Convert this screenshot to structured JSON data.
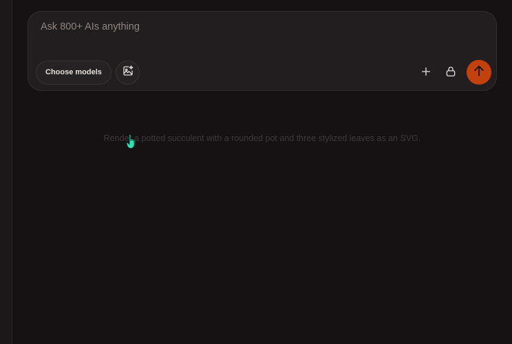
{
  "composer": {
    "placeholder": "Ask 800+ AIs anything",
    "choose_models_label": "Choose models",
    "image_gen_icon": "image-sparkle-icon",
    "plus_icon": "plus-icon",
    "lock_icon": "lock-icon",
    "send_icon": "arrow-up-icon",
    "send_color": "#c2410c"
  },
  "suggestion": {
    "text": "Render a potted succulent with a rounded pot and three stylized leaves as an SVG."
  },
  "cursor": {
    "icon": "hand-pointer-icon",
    "color": "#2ee6b4"
  }
}
